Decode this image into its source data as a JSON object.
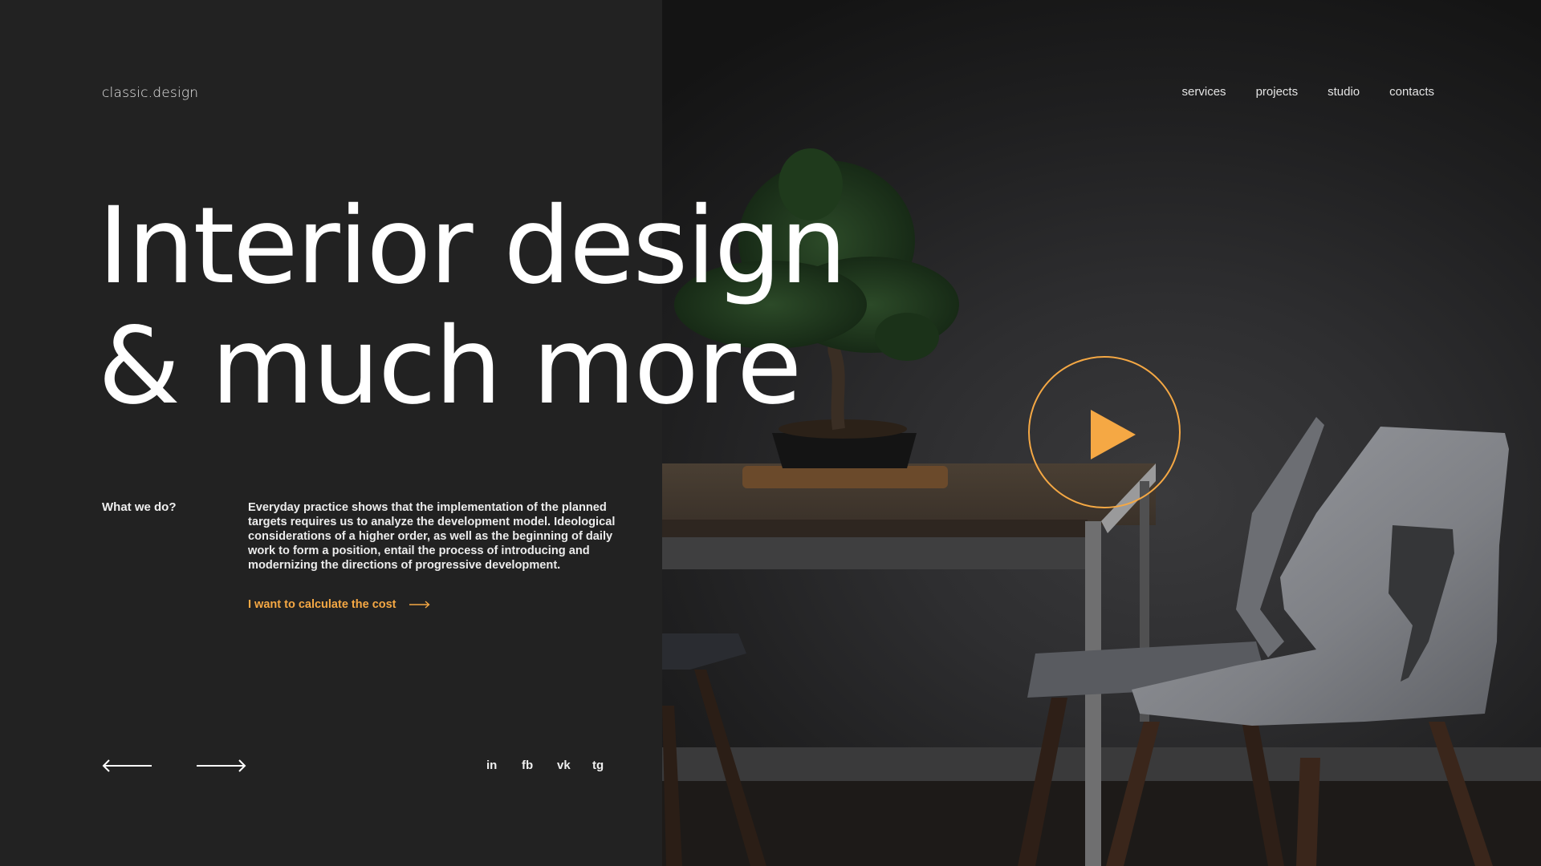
{
  "brand": {
    "logo": "classic.design",
    "accent_color": "#F5A844"
  },
  "nav": {
    "items": [
      {
        "label": "services"
      },
      {
        "label": "projects"
      },
      {
        "label": "studio"
      },
      {
        "label": "contacts"
      }
    ]
  },
  "hero": {
    "title_line1": "Interior design",
    "title_line2": "& much more"
  },
  "about": {
    "label": "What we do?",
    "description": "Everyday practice shows that the implementation of the planned targets requires us to analyze the development model. Ideological considerations of a higher order, as well as the beginning of daily work to form a position, entail the process of introducing and modernizing the directions of progressive development.",
    "cta_label": "I want to calculate the cost",
    "cta_icon": "arrow-right-icon"
  },
  "pager": {
    "prev_icon": "arrow-left-icon",
    "next_icon": "arrow-right-icon"
  },
  "social": {
    "items": [
      {
        "label": "in"
      },
      {
        "label": "fb"
      },
      {
        "label": "vk"
      },
      {
        "label": "tg"
      }
    ]
  },
  "video": {
    "icon": "play-icon"
  }
}
